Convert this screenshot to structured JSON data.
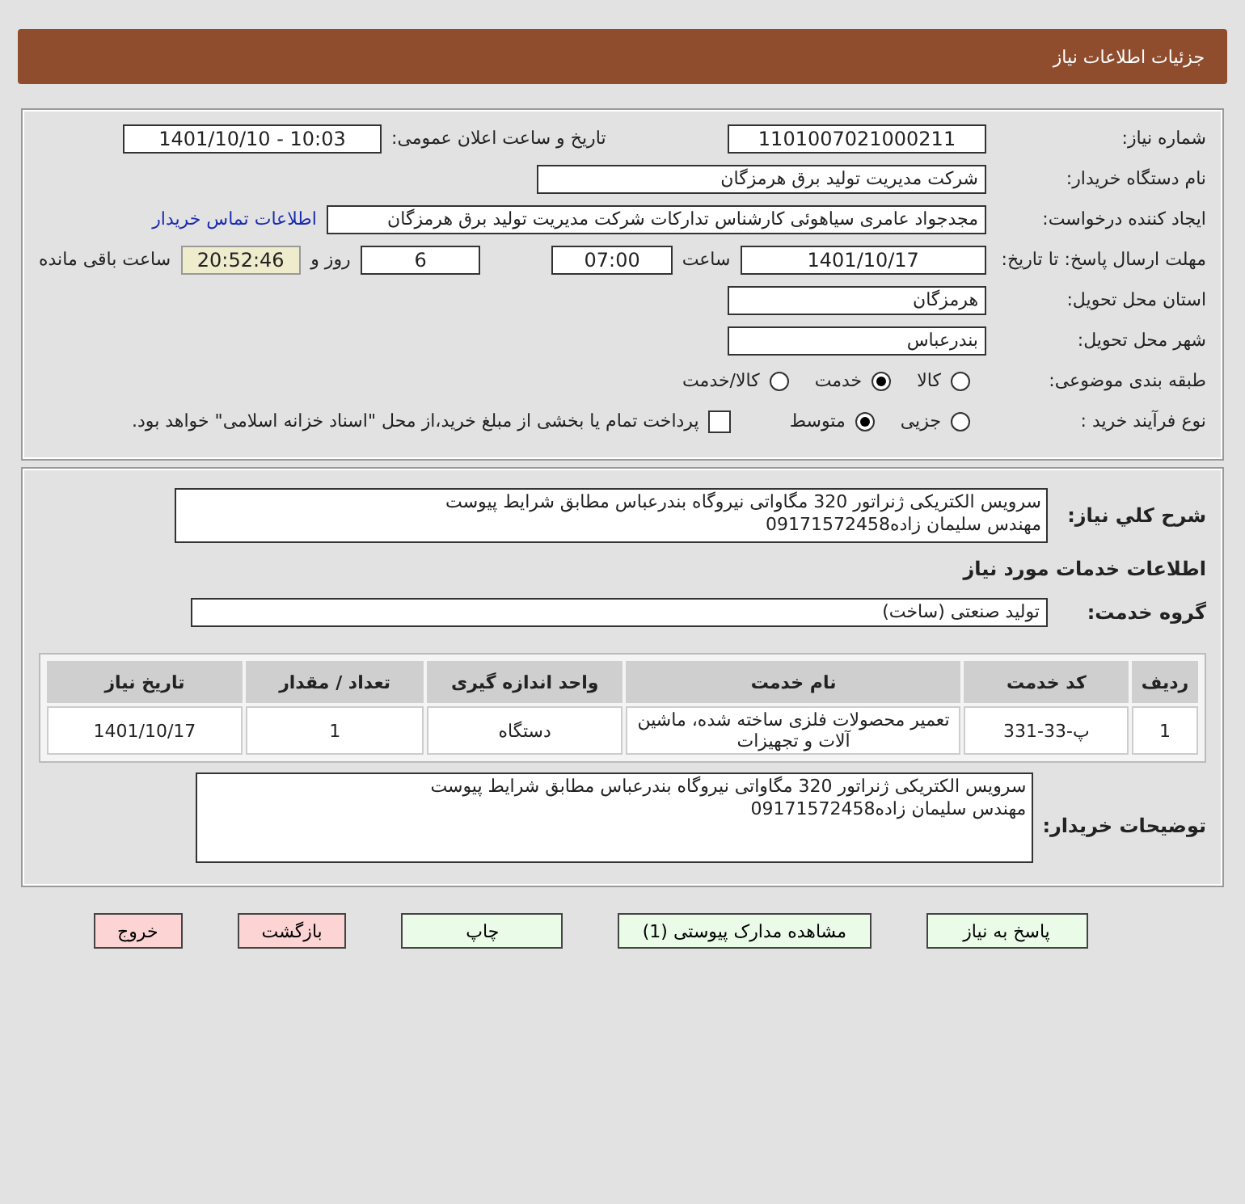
{
  "header": {
    "title": "جزئیات اطلاعات نیاز"
  },
  "need": {
    "number": {
      "label": "شماره نیاز:",
      "value": "1101007021000211"
    },
    "announce": {
      "label": "تاریخ و ساعت اعلان عمومی:",
      "value": "1401/10/10 - 10:03"
    },
    "buyer_org": {
      "label": "نام دستگاه خریدار:",
      "value": "شرکت مدیریت تولید برق هرمزگان"
    },
    "requester": {
      "label": "ایجاد کننده درخواست:",
      "value": "مجدجواد عامری سیاهوئی کارشناس تدارکات شرکت مدیریت تولید برق هرمزگان",
      "link": "اطلاعات تماس خریدار"
    },
    "deadline": {
      "label": "مهلت ارسال پاسخ: تا تاریخ:",
      "date": "1401/10/17",
      "time_label": "ساعت",
      "time": "07:00",
      "days": "6",
      "days_label": "روز و",
      "remaining": "20:52:46",
      "remaining_label": "ساعت باقی مانده"
    },
    "province": {
      "label": "استان محل تحویل:",
      "value": "هرمزگان"
    },
    "city": {
      "label": "شهر محل تحویل:",
      "value": "بندرعباس"
    },
    "category": {
      "label": "طبقه بندی موضوعی:",
      "options": [
        {
          "label": "کالا",
          "selected": false
        },
        {
          "label": "خدمت",
          "selected": true
        },
        {
          "label": "کالا/خدمت",
          "selected": false
        }
      ]
    },
    "process": {
      "label": "نوع فرآیند خرید :",
      "options": [
        {
          "label": "جزیی",
          "selected": false
        },
        {
          "label": "متوسط",
          "selected": true
        }
      ],
      "payment": {
        "label": "پرداخت تمام یا بخشی از مبلغ خرید،از محل \"اسناد خزانه اسلامی\" خواهد بود.",
        "checked": false
      }
    }
  },
  "details": {
    "description": {
      "label": "شرح کلي نياز:",
      "lines": [
        "سرویس الکتریکی ژنراتور 320 مگاواتی نیروگاه بندرعباس مطابق شرایط پیوست",
        "مهندس سلیمان زاده09171572458"
      ]
    },
    "services_title": "اطلاعات خدمات مورد نیاز",
    "service_group": {
      "label": "گروه خدمت:",
      "value": "تولید صنعتی (ساخت)"
    },
    "table": {
      "columns": [
        "ردیف",
        "کد خدمت",
        "نام خدمت",
        "واحد اندازه گیری",
        "تعداد / مقدار",
        "تاریخ نیاز"
      ],
      "rows": [
        [
          "1",
          "پ-33-331",
          "تعمیر محصولات فلزی ساخته شده، ماشین آلات و تجهیزات",
          "دستگاه",
          "1",
          "1401/10/17"
        ]
      ]
    },
    "buyer_notes": {
      "label": "توضیحات خریدار:",
      "lines": [
        "سرویس الکتریکی ژنراتور 320 مگاواتی نیروگاه بندرعباس مطابق شرایط پیوست",
        "مهندس سلیمان زاده09171572458"
      ]
    }
  },
  "buttons": [
    {
      "label": "پاسخ به نیاز",
      "kind": "action"
    },
    {
      "label": "مشاهده مدارک پیوستی (1)",
      "kind": "action"
    },
    {
      "label": "چاپ",
      "kind": "action"
    },
    {
      "label": "بازگشت",
      "kind": "exit"
    },
    {
      "label": "خروج",
      "kind": "exit"
    }
  ]
}
